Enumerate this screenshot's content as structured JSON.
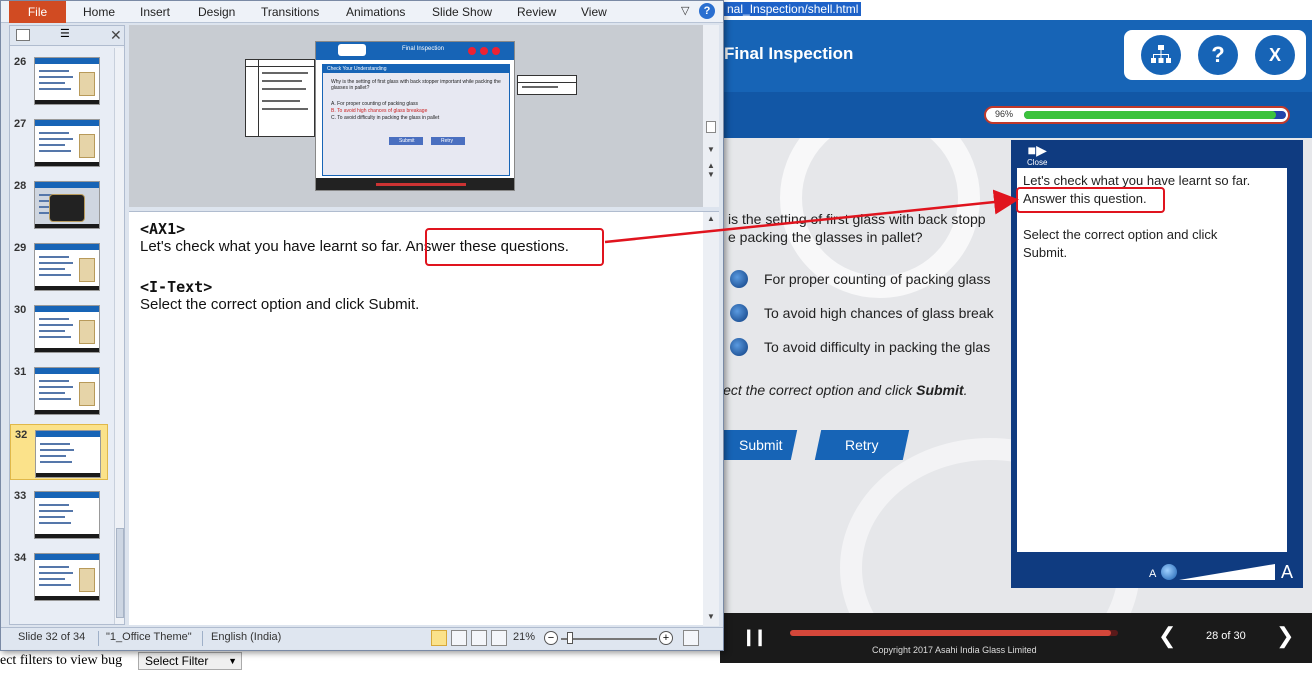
{
  "browser": {
    "url_fragment": "nal_Inspection/shell.html"
  },
  "course": {
    "title": "Final Inspection",
    "header_icons": [
      "sitemap-icon",
      "help-icon",
      "close-icon"
    ],
    "help_label": "?",
    "close_label": "X",
    "progress_text": "96%",
    "progress_value": 0.96,
    "question": "is the setting of first glass with back stopp packing the glasses in pallet?",
    "question_line1": "is the setting of first glass with back stopp",
    "question_line2": "e packing the glasses in pallet?",
    "options": [
      "For proper counting of packing glass",
      "To avoid high chances of glass break",
      "To avoid difficulty in packing the glas"
    ],
    "instruction_prefix": "lect the correct option and click ",
    "instruction_bold": "Submit",
    "instruction_suffix": ".",
    "submit_label": "Submit",
    "retry_label": "Retry",
    "copyright": "Copyright 2017 Asahi India Glass Limited",
    "page_indicator": "28 of 30",
    "seek_value": 0.98,
    "colors": {
      "brand": "#1764b6",
      "header_dark": "#1257a6",
      "progress_green": "#3cc23c",
      "highlight": "#e0141e"
    }
  },
  "transcript": {
    "close_label": "Close",
    "para1_line1": "Let's check what you have learnt so far.",
    "para1_line2": "Answer this question.",
    "para2_line1": "Select the correct option and click",
    "para2_line2": "Submit.",
    "font_small": "A",
    "font_large": "A"
  },
  "bug_filter": {
    "label": "ect filters to view bug",
    "select_value": "Select Filter"
  },
  "powerpoint": {
    "tabs": [
      "File",
      "Home",
      "Insert",
      "Design",
      "Transitions",
      "Animations",
      "Slide Show",
      "Review",
      "View"
    ],
    "help_label": "?",
    "thumbnails": [
      "26",
      "27",
      "28",
      "29",
      "30",
      "31",
      "32",
      "33",
      "34"
    ],
    "selected_slide": "32",
    "mini_slide": {
      "title": "Final Inspection",
      "popup_heading": "Check Your Understanding",
      "question": "Why is the setting of first glass with back stopper  important while packing the glasses in pallet?",
      "options": [
        "A. For proper counting of packing glass",
        "B. To avoid high chances of glass breakage",
        "C. To avoid difficulty in packing the glass in pallet"
      ],
      "submit": "Submit",
      "retry": "Retry"
    },
    "notes": {
      "tag1": "<AX1>",
      "text1_before": "Let's check what you have learnt so far. ",
      "text1_highlight": "Answer these questions.",
      "tag2": "<I-Text>",
      "text2": "Select the correct option and click Submit."
    },
    "status": {
      "slide_info": "Slide 32 of 34",
      "theme": "\"1_Office Theme\"",
      "language": "English (India)",
      "zoom": "21%"
    }
  }
}
